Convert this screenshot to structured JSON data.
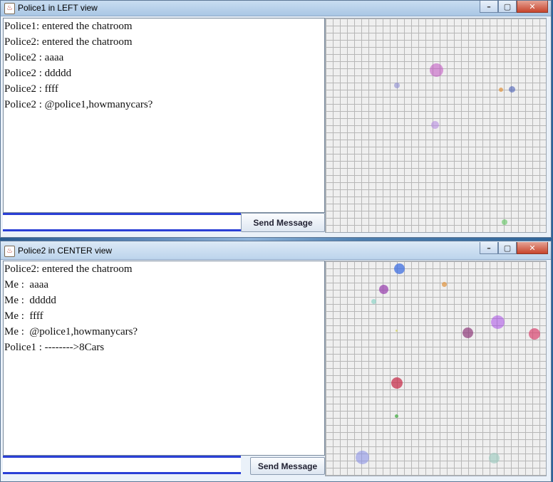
{
  "windows": [
    {
      "title": "Police1 in LEFT view",
      "messages": [
        "Police1: entered the chatroom",
        "Police2: entered the chatroom",
        "Police2 : aaaa",
        "Police2 : ddddd",
        "Police2 : ffff",
        "Police2 : @police1,howmanycars?"
      ],
      "input_value": "",
      "send_label": "Send Message"
    },
    {
      "title": "Police2 in CENTER view",
      "messages": [
        "Police2: entered the chatroom",
        "Me :  aaaa",
        "Me :  ddddd",
        "Me :  ffff",
        "Me :  @police1,howmanycars?",
        "Police1 : -------->8Cars"
      ],
      "input_value": "",
      "send_label": "Send Message"
    }
  ],
  "caption_buttons": {
    "minimize": "–",
    "maximize": "▢",
    "close": "✕"
  },
  "colors": {
    "input_border": "#2a3fd6",
    "grid_line": "#b7b7b7",
    "grid_bg": "#efefef"
  }
}
